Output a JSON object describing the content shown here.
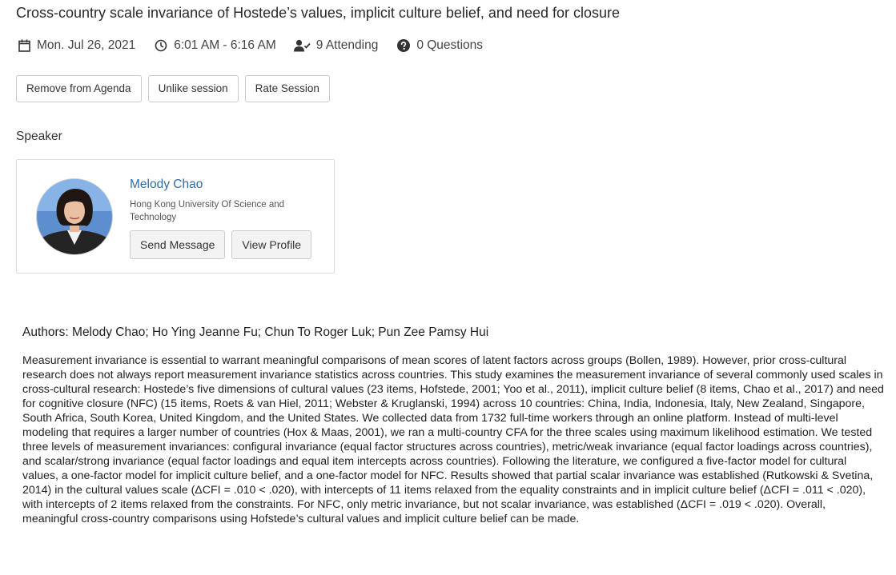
{
  "session": {
    "title": "Cross-country scale invariance of Hostede’s values, implicit culture belief, and need for closure",
    "date": "Mon. Jul 26, 2021",
    "time": "6:01 AM - 6:16 AM",
    "attending": "9 Attending",
    "questions": "0 Questions",
    "icons": {
      "date": "calendar-icon",
      "time": "clock-icon",
      "attending": "user-check-icon",
      "questions": "question-circle-icon"
    }
  },
  "actions": {
    "remove_agenda": "Remove from Agenda",
    "unlike": "Unlike session",
    "rate": "Rate Session"
  },
  "speaker_section": {
    "heading": "Speaker",
    "name": "Melody Chao",
    "organization": "Hong Kong University Of Science and Technology",
    "send_message": "Send Message",
    "view_profile": "View Profile",
    "name_color": "#2f6ea8"
  },
  "authors": "Authors: Melody Chao; Ho Ying Jeanne Fu; Chun To Roger Luk; Pun Zee Pamsy Hui",
  "abstract": "Measurement invariance is essential to warrant meaningful comparisons of mean scores of latent factors across groups (Bollen, 1989). However, prior cross-cultural research does not always report measurement invariance statistics across countries. This study examines the measurement invariance of several commonly used scales in cross-cultural research: Hostede’s five dimensions of cultural values (23 items, Hofstede, 2001; Yoo et al., 2011), implicit culture belief (8 items, Chao et al., 2017) and need for cognitive closure (NFC) (15 items, Roets & van Hiel, 2011; Webster & Kruglanski, 1994) across 10 countries: China, India, Indonesia, Italy, New Zealand, Singapore, South Africa, South Korea, United Kingdom, and the United States. We collected data from 1732 full-time workers through an online platform. Instead of multi-level modeling that requires a larger number of countries (Hox & Maas, 2001), we ran a multi-country CFA for the three scales using maximum likelihood estimation. We tested three levels of measurement invariances: configural invariance (equal factor structures across countries), metric/weak invariance (equal factor loadings across countries), and scalar/strong invariance (equal factor loadings and equal item intercepts across countries). Following the literature, we configured a five-factor model for cultural values, a one-factor model for implicit culture belief, and a one-factor model for NFC. Results showed that partial scalar invariance was established (Rutkowski & Svetina, 2014) in the cultural values scale (ΔCFI = .010 < .020), with intercepts of 11 items relaxed from the equality constraints and in implicit culture belief (ΔCFI = .011 < .020), with intercepts of 2 items relaxed from the constraints. For NFC, only metric invariance, but not scalar invariance, was established (ΔCFI = .019 < .020). Overall, meaningful cross-country comparisons using Hofstede’s cultural values and implicit culture belief can be made."
}
